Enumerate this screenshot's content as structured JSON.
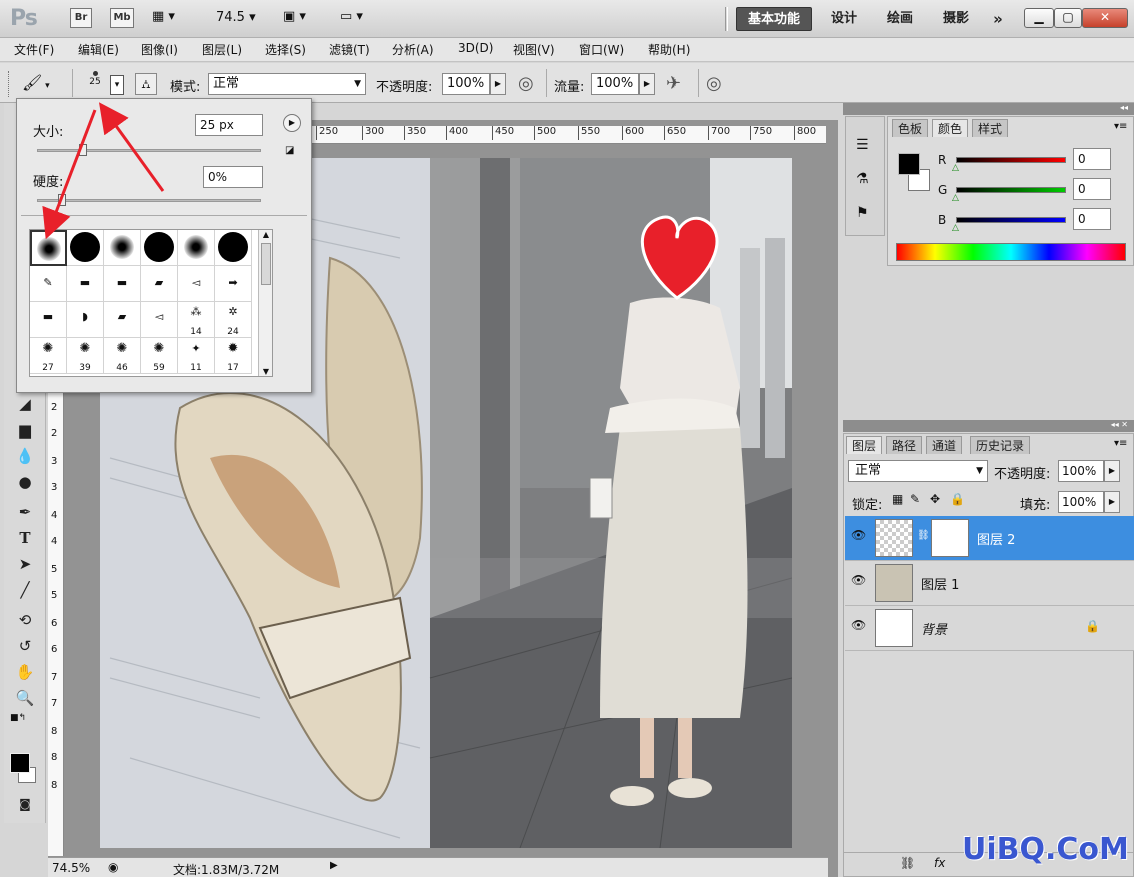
{
  "app": {
    "logo": "Ps",
    "bridge": "Br",
    "minibridge": "Mb",
    "zoom": "74.5"
  },
  "workspaces": [
    "基本功能",
    "设计",
    "绘画",
    "摄影"
  ],
  "more_workspaces": "»",
  "menu": [
    "文件(F)",
    "编辑(E)",
    "图像(I)",
    "图层(L)",
    "选择(S)",
    "滤镜(T)",
    "分析(A)",
    "3D(D)",
    "视图(V)",
    "窗口(W)",
    "帮助(H)"
  ],
  "options": {
    "brush_size": "25",
    "mode_label": "模式:",
    "mode_value": "正常",
    "opacity_label": "不透明度:",
    "opacity_value": "100%",
    "flow_label": "流量:",
    "flow_value": "100%"
  },
  "brush_popup": {
    "size_label": "大小:",
    "size_value": "25 px",
    "size_fraction": 0.1,
    "hardness_label": "硬度:",
    "hardness_value": "0%",
    "hardness_fraction": 0.0,
    "presets_row3_numbers": [
      "14",
      "24"
    ],
    "presets_row4_numbers": [
      "27",
      "39",
      "46",
      "59",
      "11",
      "17"
    ]
  },
  "ruler_top": [
    "250",
    "300",
    "350",
    "400",
    "450",
    "500",
    "550",
    "600",
    "650",
    "700",
    "750",
    "800"
  ],
  "ruler_left": [
    "2",
    "2",
    "3",
    "3",
    "4",
    "4",
    "5",
    "5",
    "6",
    "6",
    "7",
    "7",
    "8",
    "8",
    "8"
  ],
  "status": {
    "zoom": "74.5%",
    "doc": "文档:1.83M/3.72M"
  },
  "color_panel": {
    "tabs": [
      "色板",
      "颜色",
      "样式"
    ],
    "active_tab": "颜色",
    "r_label": "R",
    "r_value": "0",
    "g_label": "G",
    "g_value": "0",
    "b_label": "B",
    "b_value": "0"
  },
  "layers_panel": {
    "tabs": [
      "图层",
      "路径",
      "通道",
      "历史记录"
    ],
    "blend_mode": "正常",
    "opacity_label": "不透明度:",
    "opacity_value": "100%",
    "lock_label": "锁定:",
    "fill_label": "填充:",
    "fill_value": "100%",
    "layers": [
      {
        "name": "图层 2",
        "selected": true
      },
      {
        "name": "图层 1",
        "selected": false
      },
      {
        "name": "背景",
        "selected": false
      }
    ]
  },
  "watermark": "UiBQ.CoM",
  "colors": {
    "selection": "#3d8ee0",
    "arrow": "#e8202a",
    "heart": "#e8202a"
  }
}
